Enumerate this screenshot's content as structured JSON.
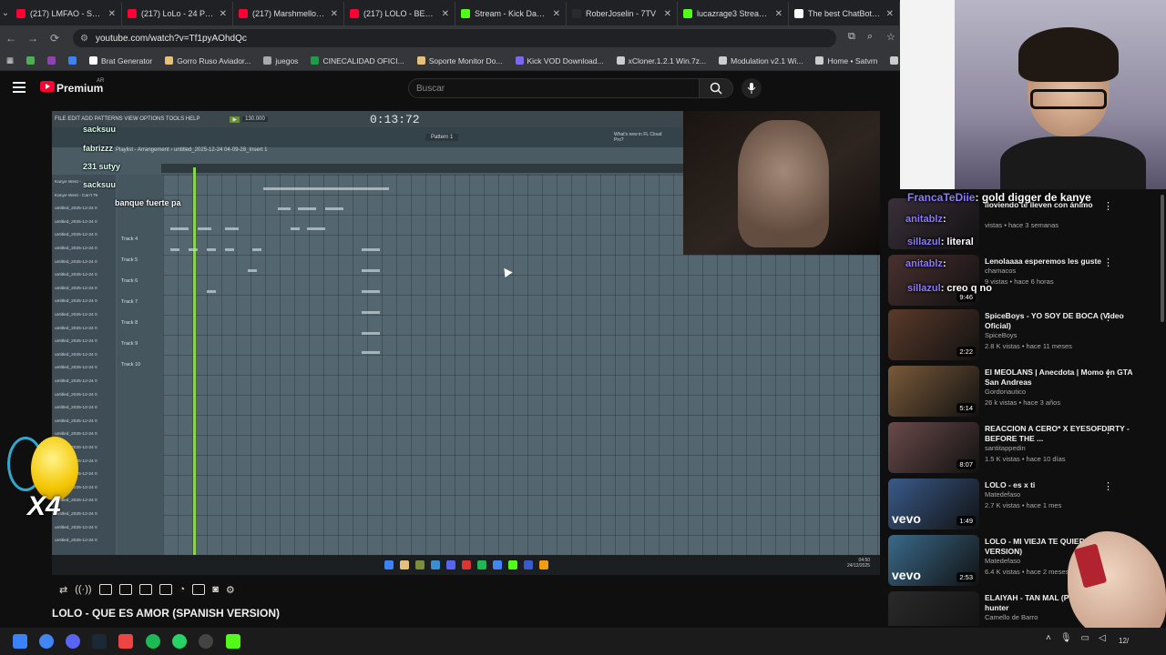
{
  "browser": {
    "tabs": [
      {
        "title": "(217) LMFAO - Sexy a",
        "color": "#ff0033"
      },
      {
        "title": "(217) LoLo - 24 PERR",
        "color": "#ff0033"
      },
      {
        "title": "(217) Marshmello - Y",
        "color": "#ff0033"
      },
      {
        "title": "(217) LOLO - BEAUTY",
        "color": "#ff0033"
      },
      {
        "title": "Stream - Kick Dashb",
        "color": "#53fc18"
      },
      {
        "title": "RoberJoselin - 7TV",
        "color": "#2a2a2a"
      },
      {
        "title": "lucazrage3 Stream -",
        "color": "#53fc18"
      },
      {
        "title": "The best ChatBot an",
        "color": "#ffffff"
      }
    ],
    "url": "youtube.com/watch?v=Tf1pyAOhdQc",
    "bookmarks": [
      {
        "label": "Brat Generator",
        "color": "#ffffff"
      },
      {
        "label": "Gorro Ruso Aviador...",
        "color": "#e5c07b"
      },
      {
        "label": "juegos",
        "color": "#aaaaaa"
      },
      {
        "label": "CINECALIDAD OFICI...",
        "color": "#1c9e45"
      },
      {
        "label": "Soporte Monitor Do...",
        "color": "#e5c07b"
      },
      {
        "label": "Kick VOD Download...",
        "color": "#7b68ee"
      },
      {
        "label": "xCloner.1.2.1 Win.7z...",
        "color": "#cccccc"
      },
      {
        "label": "Modulation v2.1 Wi...",
        "color": "#cccccc"
      },
      {
        "label": "Home • Satvrn",
        "color": "#cccccc"
      },
      {
        "label": "Control Roo",
        "color": "#cccccc"
      }
    ]
  },
  "youtube": {
    "brand": "Premium",
    "country": "AR",
    "search_placeholder": "Buscar",
    "video_title": "LOLO - QUE ES AMOR (SPANISH VERSION)"
  },
  "fl": {
    "menu": "FILE EDIT ADD PATTERNS VIEW OPTIONS TOOLS HELP",
    "tempo": "130.000",
    "time": "0:13:72",
    "pattern": "Pattern 1",
    "playlist_title": "Playlist - Arrangement › untitled_2025-12-24 04-09-28_Insert 1",
    "tracks": [
      "Track 4",
      "Track 5",
      "Track 6",
      "Track 7",
      "Track 8",
      "Track 9",
      "Track 10"
    ],
    "left_rows": [
      "Kanye West - ...",
      "Kanye West - Can't Te",
      "untitled_2025-12-24 0",
      "untitled_2025-12-24 0",
      "untitled_2025-12-24 0",
      "untitled_2025-12-24 0",
      "untitled_2025-12-24 0",
      "untitled_2025-12-24 0",
      "untitled_2025-12-24 0",
      "untitled_2025-12-24 0",
      "untitled_2025-12-24 0",
      "untitled_2025-12-24 0",
      "untitled_2025-12-24 0",
      "untitled_2025-12-24 0",
      "untitled_2025-12-24 0",
      "untitled_2025-12-24 0",
      "untitled_2025-12-24 0",
      "untitled_2025-12-24 0",
      "untitled_2025-12-24 0",
      "untitled_2025-12-24 0",
      "untitled_2025-12-24 0",
      "untitled_2025-12-24 0",
      "untitled_2025-12-24 0",
      "untitled_2025-12-24 0",
      "untitled_2025-12-24 0",
      "untitled_2025-12-24 0",
      "untitled_2025-12-24 0",
      "untitled_2025-12-24 0"
    ],
    "whats_new": "What's new in FL Cloud Pro?",
    "inner_clock": "04:50\n24/12/2025"
  },
  "stream_chat_video": [
    {
      "user": "sacksuu",
      "text": ""
    },
    {
      "user": "fabrizzz",
      "text": ""
    },
    {
      "user": "231 sutyy",
      "text": ""
    },
    {
      "user": "sacksuu",
      "text": ""
    },
    {
      "user": "",
      "text": "banque fuerte pa"
    }
  ],
  "stream_chat_side": [
    {
      "user": "FrancaTeDiie",
      "text": ": gold digger de kanye"
    },
    {
      "user": "anitablz",
      "text": ":"
    },
    {
      "user": "sillazul",
      "text": ": literal"
    },
    {
      "user": "anitablz",
      "text": ":"
    },
    {
      "user": "sillazul",
      "text": ": creo q no"
    }
  ],
  "recommendations": [
    {
      "title": "lloviendo te lleven con ánimo",
      "channel": "",
      "meta": "vistas • hace 3 semanas",
      "duration": ""
    },
    {
      "title": "Lenolaaaa esperemos les guste",
      "channel": "chamacos",
      "meta": "9 vistas • hace 6 horas",
      "duration": "9:46"
    },
    {
      "title": "SpiceBoys - YO SOY DE BOCA (Video Oficial)",
      "channel": "SpiceBoys",
      "meta": "2.8 K vistas • hace 11 meses",
      "duration": "2:22"
    },
    {
      "title": "El MEOLANS | Anecdota | Momo en GTA San Andreas",
      "channel": "Gordonautico",
      "meta": "26 k vistas • hace 3 años",
      "duration": "5:14"
    },
    {
      "title": "REACCION A CERO* X EYESOFDIRTY - BEFORE THE ...",
      "channel": "santitappedin",
      "meta": "1.5 K vistas • hace 10 días",
      "duration": "8:07"
    },
    {
      "title": "LOLO - es x ti",
      "channel": "Matedefaso",
      "meta": "2.7 K vistas • hace 1 mes",
      "duration": "1:49"
    },
    {
      "title": "LOLO - MI VIEJA TE QUIERE (SPANISH VERSION)",
      "channel": "Matedefaso",
      "meta": "6.4 K vistas • hace 2 meses",
      "duration": "2:53"
    },
    {
      "title": "ELAIYAH - TAN MAL (PROD.ELAIYAH) hunter",
      "channel": "Camello de Barro",
      "meta": "",
      "duration": ""
    }
  ],
  "emote_label": "X4",
  "taskbar_clock": "12/"
}
